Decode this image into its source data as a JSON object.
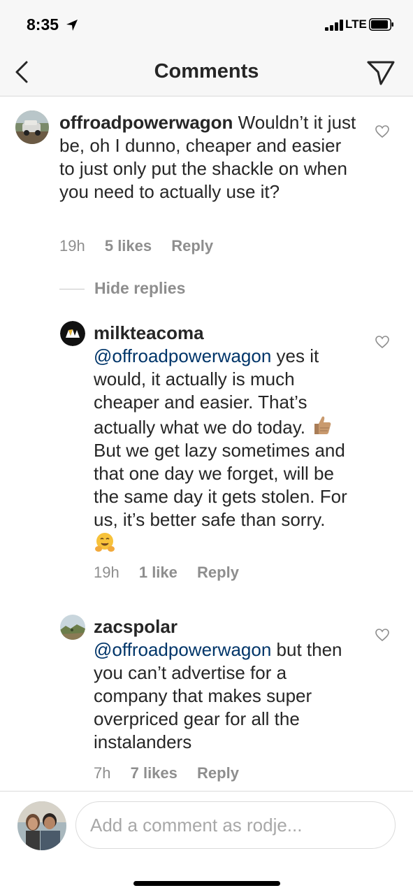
{
  "status_bar": {
    "time": "8:35",
    "network": "LTE"
  },
  "nav": {
    "title": "Comments"
  },
  "comments": [
    {
      "username": "offroadpowerwagon",
      "text": "Wouldn’t it just be, oh I dunno, cheaper and easier to just only put the shackle on when you need to actually use it?",
      "time": "19h",
      "likes": "5 likes",
      "reply": "Reply"
    }
  ],
  "hide_replies": "Hide replies",
  "replies": [
    {
      "username": "milkteacoma",
      "mention": "@offroadpowerwagon",
      "text_1": " yes it would, it actually is much cheaper and easier. That’s actually what we do today.",
      "text_2": "But we get lazy sometimes and that one day we forget, will be the same day it gets stolen. For us, it’s better safe than sorry.",
      "time": "19h",
      "likes": "1 like",
      "reply": "Reply"
    },
    {
      "username": "zacspolar",
      "mention": "@offroadpowerwagon",
      "text": " but then you can’t advertise for a company that makes super overpriced gear for all the instalanders",
      "time": "7h",
      "likes": "7 likes",
      "reply": "Reply"
    }
  ],
  "composer": {
    "placeholder": "Add a comment as rodje..."
  },
  "icons": {
    "back": "chevron-left-icon",
    "send": "direct-send-icon",
    "like": "heart-outline-icon",
    "location": "location-arrow-icon",
    "signal": "cellular-signal-icon",
    "battery": "battery-icon"
  }
}
